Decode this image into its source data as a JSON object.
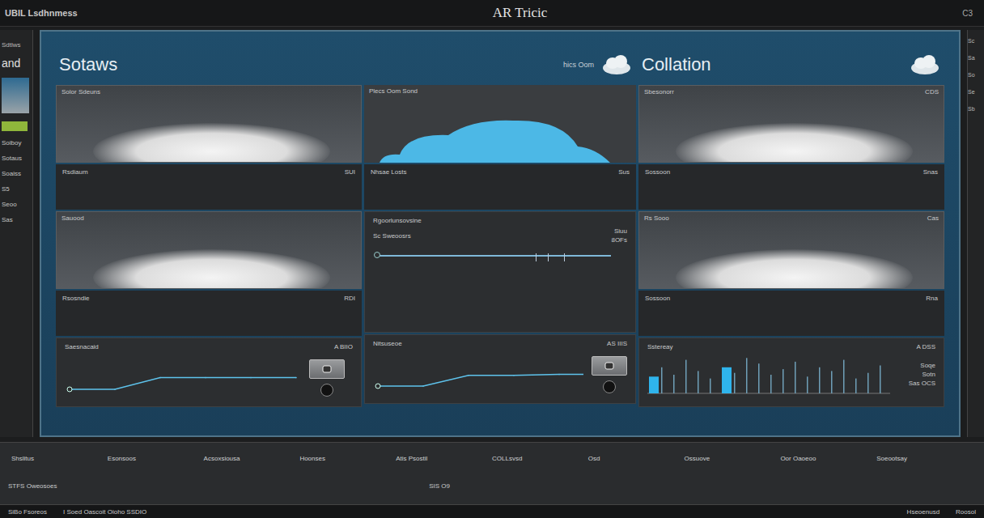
{
  "window": {
    "brand": "UBIL Lsdhnmess",
    "title": "AR Tricic",
    "corner": "C3"
  },
  "sidebar": {
    "caption": "Sdtlws",
    "heading": "and",
    "items": [
      "Soiboy",
      "Sotaus",
      "Soaiss",
      "S5",
      "Seoo",
      "Sas"
    ]
  },
  "right_strip": {
    "items": [
      "Sc",
      "Sa",
      "So",
      "Se",
      "Sb"
    ]
  },
  "columns": [
    {
      "title": "Sotaws",
      "size": "large",
      "cards": [
        {
          "kind": "photo",
          "label": "Solor Sdeuns",
          "value": ""
        },
        {
          "kind": "caption",
          "label": "Rsdiaum",
          "value": "SUI"
        },
        {
          "kind": "photo",
          "label": "Sauood",
          "value": ""
        },
        {
          "kind": "caption",
          "label": "Rsosndie",
          "value": "RDI"
        },
        {
          "kind": "line-chart",
          "label": "Saesnacaid",
          "value": "A BIIO",
          "values": [
            0,
            0,
            0.6,
            0.6,
            0.6,
            0.6
          ]
        }
      ]
    },
    {
      "title": "hics Oom",
      "size": "small",
      "cards": [
        {
          "kind": "illustration",
          "label": "Plecs Oom Sond",
          "value": ""
        },
        {
          "kind": "caption",
          "label": "Nhsae Losts",
          "value": "Sus"
        },
        {
          "kind": "slider",
          "label": "Rgoorlunsovsine",
          "sublabel": "Sc Sweoosrs",
          "readings": [
            "Siuu",
            "8OFs"
          ],
          "level": 0,
          "marks": [
            0.68,
            0.73,
            0.8
          ]
        },
        {
          "kind": "line-chart",
          "label": "Nitsuseoe",
          "value": "AS IIIS",
          "values": [
            0,
            0,
            0.55,
            0.55,
            0.6,
            0.6
          ]
        }
      ]
    },
    {
      "title": "Collation",
      "size": "large",
      "cards": [
        {
          "kind": "photo",
          "label": "Sbesonorr",
          "value": "CDS"
        },
        {
          "kind": "caption",
          "label": "Sossoon",
          "value": "Snas"
        },
        {
          "kind": "photo",
          "label": "Rs Sooo",
          "value": "Cas"
        },
        {
          "kind": "caption",
          "label": "Sossoon",
          "value": "Rna"
        },
        {
          "kind": "bar-chart",
          "label": "Sstereay",
          "value": "A DSS",
          "sublabel": "Soqe",
          "readings": [
            "Sotn",
            "Sas OCS"
          ],
          "bars": [
            {
              "value": 0.45,
              "selected": true
            },
            {
              "value": 0.7,
              "selected": false
            },
            {
              "value": 0.5,
              "selected": false
            },
            {
              "value": 0.9,
              "selected": false
            },
            {
              "value": 0.6,
              "selected": false
            },
            {
              "value": 0.4,
              "selected": false
            },
            {
              "value": 0.7,
              "selected": true
            },
            {
              "value": 0.55,
              "selected": false
            },
            {
              "value": 0.95,
              "selected": false
            },
            {
              "value": 0.8,
              "selected": false
            },
            {
              "value": 0.5,
              "selected": false
            },
            {
              "value": 0.65,
              "selected": false
            },
            {
              "value": 0.85,
              "selected": false
            },
            {
              "value": 0.45,
              "selected": false
            },
            {
              "value": 0.7,
              "selected": false
            },
            {
              "value": 0.6,
              "selected": false
            },
            {
              "value": 0.9,
              "selected": false
            },
            {
              "value": 0.4,
              "selected": false
            },
            {
              "value": 0.55,
              "selected": false
            },
            {
              "value": 0.75,
              "selected": false
            }
          ]
        }
      ]
    }
  ],
  "table": {
    "columns": [
      "Shslitus",
      "Esonsoos",
      "Acsoxsiousa",
      "Hoonses",
      "Atis Psostil",
      "COLLsvsd",
      "Osd",
      "Ossuove",
      "Oor Oaoeoo",
      "Soeootsay"
    ],
    "row": {
      "label": "STFS Oweosoes",
      "value": "SIS O9"
    }
  },
  "status_bar": {
    "left": "SiBo Fsoreos",
    "middle": "I Soed Oascoit Oioho SSDIO",
    "right": [
      "Hseoenusd",
      "Roosol"
    ]
  }
}
